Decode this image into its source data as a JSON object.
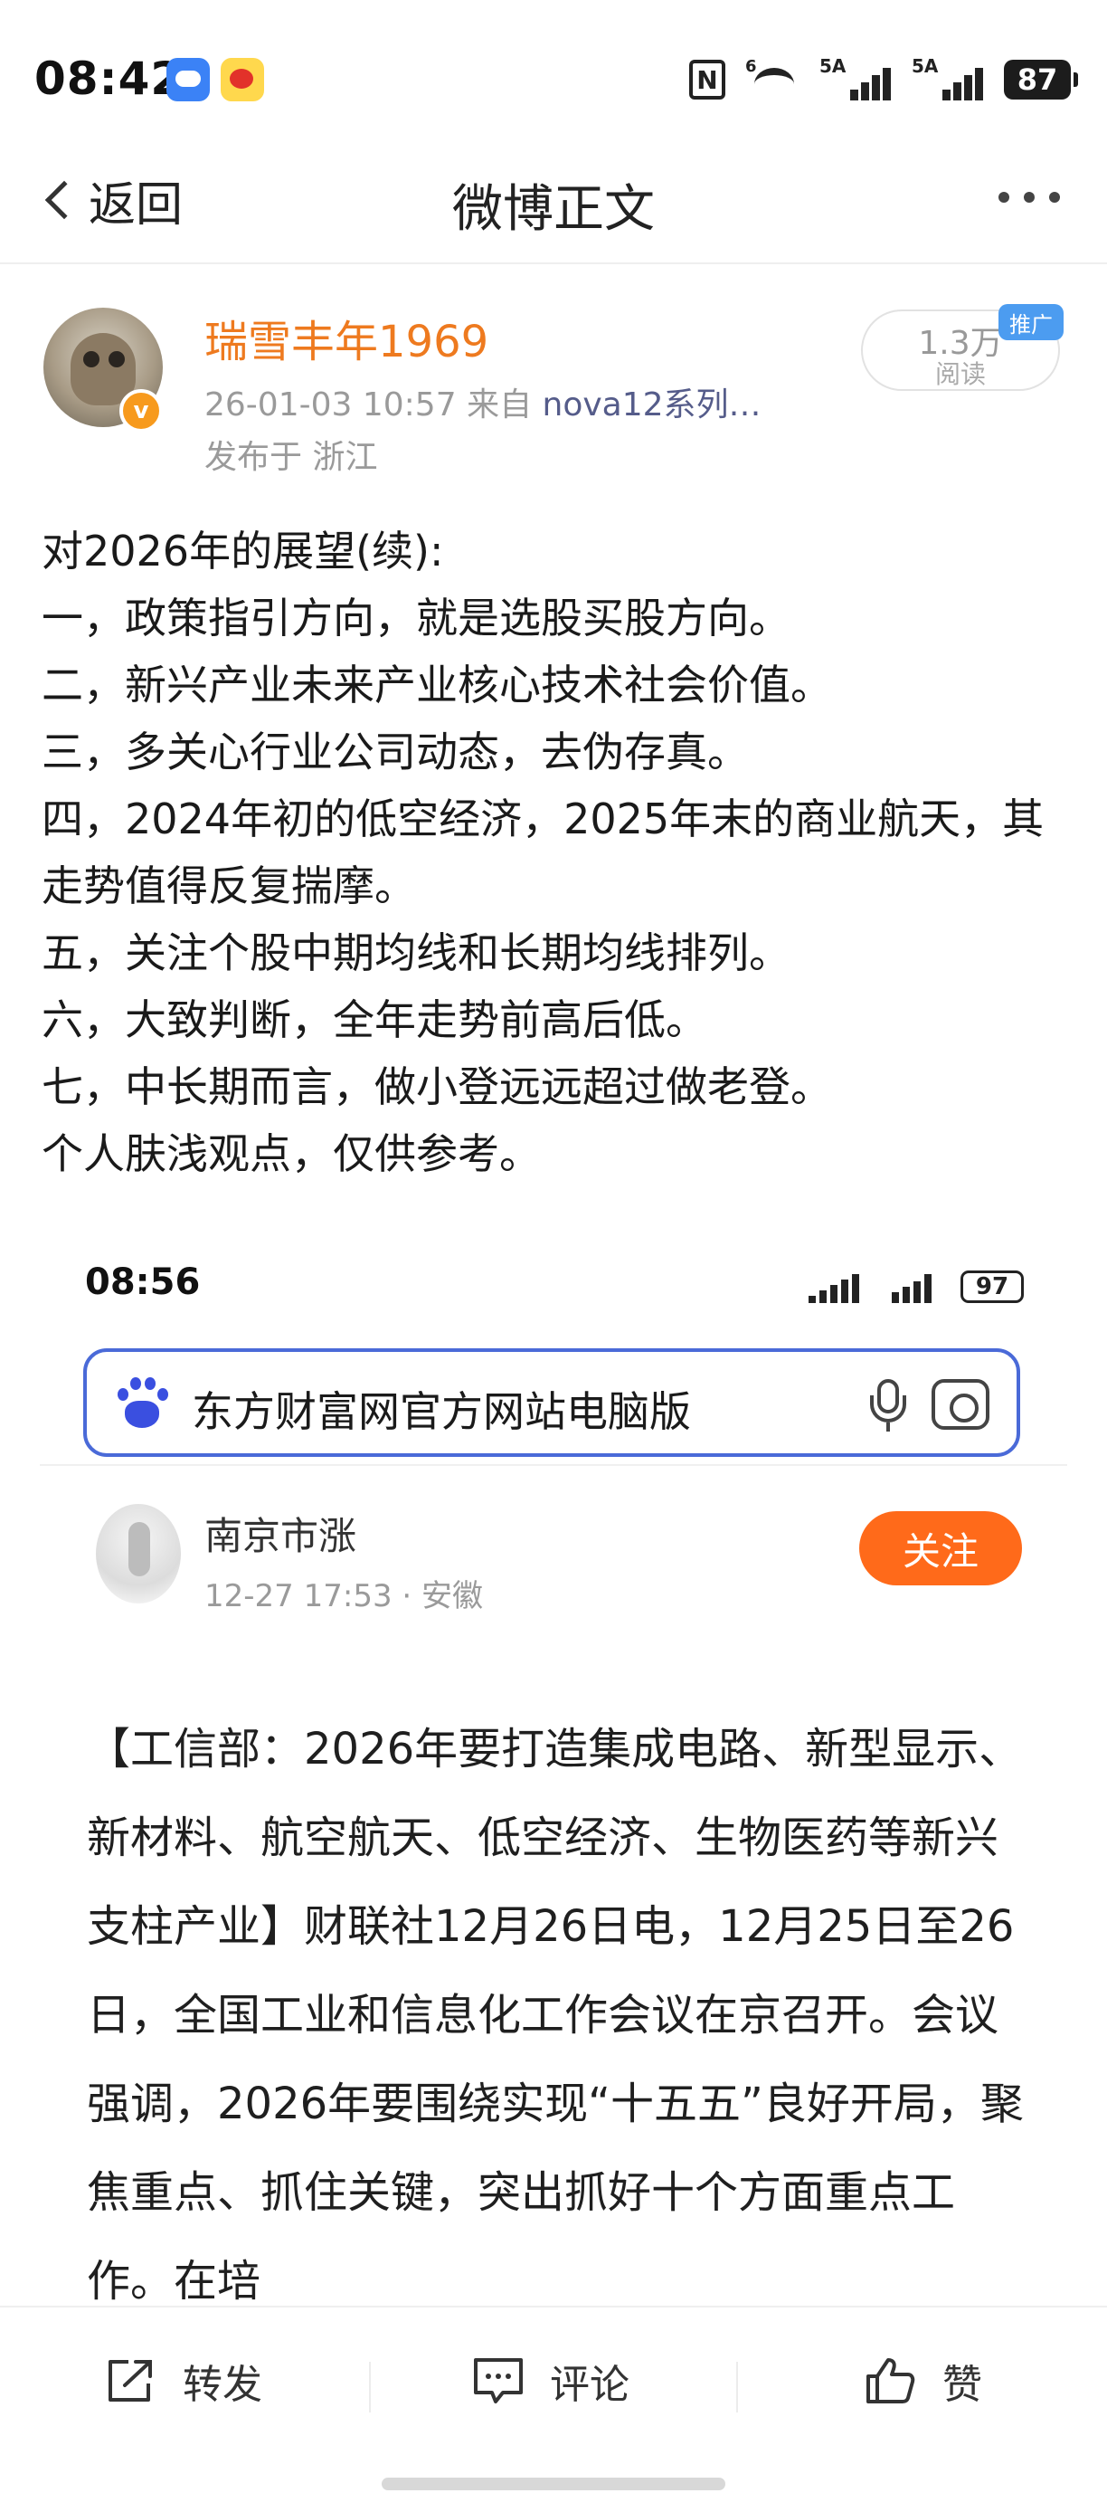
{
  "status_bar": {
    "time": "08:42",
    "apps": [
      "weather-app-icon",
      "weibo-app-icon"
    ],
    "nfc": "N",
    "wifi": "6",
    "sim1": "5A",
    "sim2": "5A",
    "battery": "87"
  },
  "nav": {
    "back_label": "返回",
    "title": "微博正文"
  },
  "post": {
    "author": "瑞雪丰年1969",
    "date": "26-01-03 10:57",
    "source_prefix": "来自",
    "source_device": "nova12系列…",
    "location": "发布于 浙江",
    "read_count": "1.3万",
    "read_label": "阅读",
    "promo_tag": "推广",
    "verified_badge": "v",
    "lines": [
      "对2026年的展望(续):",
      "一，政策指引方向，就是选股买股方向。",
      "二，新兴产业未来产业核心技术社会价值。",
      "三，多关心行业公司动态，去伪存真。",
      "四，2024年初的低空经济，2025年末的商业航天，其走势值得反复揣摩。",
      "五，关注个股中期均线和长期均线排列。",
      "六，大致判断，全年走势前高后低。",
      "七，中长期而言，做小登远远超过做老登。",
      "个人肤浅观点，仅供参考。"
    ]
  },
  "embedded": {
    "time": "08:56",
    "battery": "97",
    "search_text": "东方财富网官方网站电脑版",
    "author": "南京市涨",
    "meta": "12-27 17:53 · 安徽",
    "follow_label": "关注",
    "article": "【工信部：2026年要打造集成电路、新型显示、新材料、航空航天、低空经济、生物医药等新兴支柱产业】财联社12月26日电，12月25日至26日，全国工业和信息化工作会议在京召开。会议强调，2026年要围绕实现“十五五”良好开局，聚焦重点、抓住关键，突出抓好十个方面重点工作。在培"
  },
  "actions": {
    "repost": "转发",
    "comment": "评论",
    "like": "赞"
  },
  "colors": {
    "author_name": "#ee7a1f",
    "follow_button": "#ff6a1a",
    "search_border": "#4a6ad8",
    "promo_tag": "#4c9cf0"
  }
}
